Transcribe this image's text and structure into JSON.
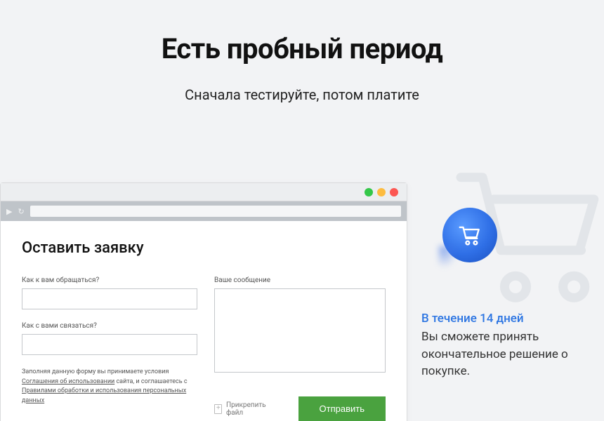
{
  "hero": {
    "title": "Есть пробный период",
    "subtitle": "Сначала тестируйте, потом платите"
  },
  "form": {
    "title": "Оставить заявку",
    "name_label": "Как к вам обращаться?",
    "name_value": "",
    "contact_label": "Как с вами связаться?",
    "contact_value": "",
    "message_label": "Ваше сообщение",
    "message_value": "",
    "legal_prefix": "Заполняя данную форму вы принимаете условия ",
    "legal_link1": "Соглашения об использовании",
    "legal_mid": " сайта, и соглашаетесь с ",
    "legal_link2": "Правилами обработки и использования персональных данных",
    "attach_label": "Прикрепить файл",
    "submit_label": "Отправить"
  },
  "feature": {
    "headline": "В течение 14 дней",
    "body": "Вы сможете принять окончательное решение о покупке."
  }
}
